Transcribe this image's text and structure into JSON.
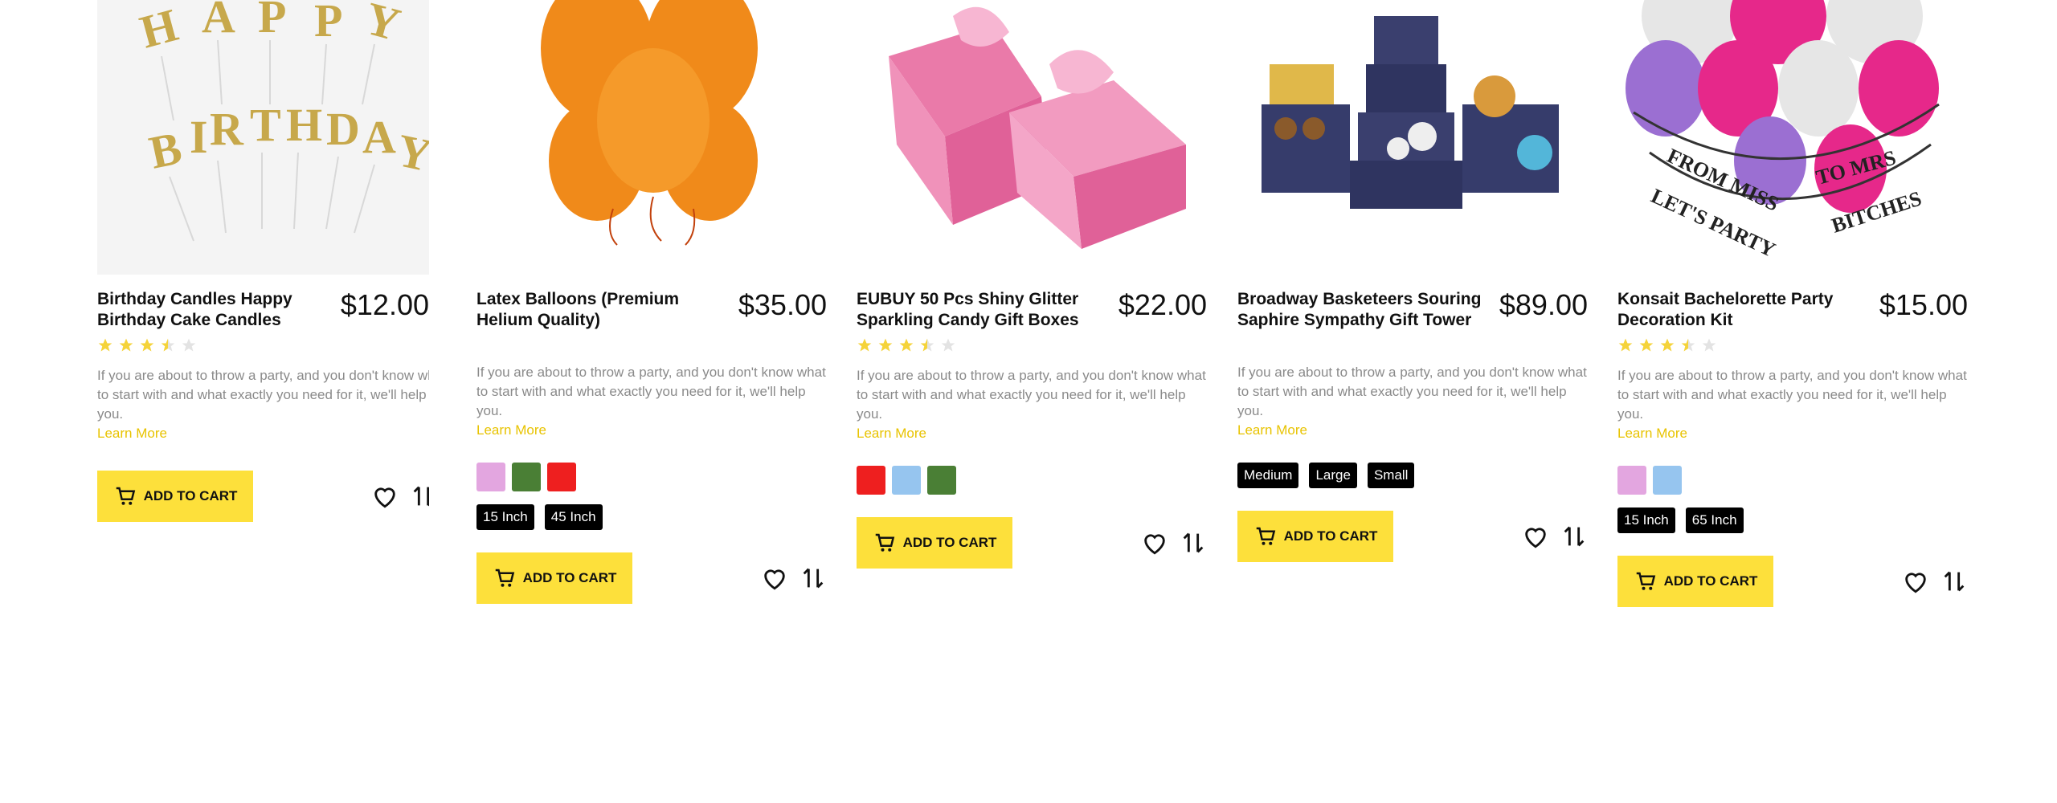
{
  "products": [
    {
      "title": "Birthday Candles Happy Birthday Cake Candles",
      "price": "$12.00",
      "rating_stars": 3.5,
      "description": "If you are about to throw a party, and you don't know what to start with and what exactly you need for it, we'll help you.",
      "learn_more": "Learn More",
      "swatches": [],
      "tags": [],
      "add_to_cart": "ADD TO CART",
      "image_icon": "birthday-candles-image"
    },
    {
      "title": "Latex Balloons (Premium Helium Quality)",
      "price": "$35.00",
      "rating_stars": 0,
      "description": "If you are about to throw a party, and you don't know what to start with and what exactly you need for it, we'll help you.",
      "learn_more": "Learn More",
      "swatches": [
        "#e3a6e0",
        "#4a7f35",
        "#ee1f1f"
      ],
      "tags": [
        "15 Inch",
        "45 Inch"
      ],
      "add_to_cart": "ADD TO CART",
      "image_icon": "orange-balloons-image"
    },
    {
      "title": "EUBUY 50 Pcs Shiny Glitter Sparkling Candy Gift Boxes",
      "price": "$22.00",
      "rating_stars": 3.5,
      "description": "If you are about to throw a party, and you don't know what to start with and what exactly you need for it, we'll help you.",
      "learn_more": "Learn More",
      "swatches": [
        "#ee1f1f",
        "#96c5ef",
        "#4a7f35"
      ],
      "tags": [],
      "add_to_cart": "ADD TO CART",
      "image_icon": "pink-gift-boxes-image"
    },
    {
      "title": "Broadway Basketeers Souring Saphire Sympathy Gift Tower",
      "price": "$89.00",
      "rating_stars": 0,
      "description": "If you are about to throw a party, and you don't know what to start with and what exactly you need for it, we'll help you.",
      "learn_more": "Learn More",
      "swatches": [],
      "tags": [
        "Medium",
        "Large",
        "Small"
      ],
      "add_to_cart": "ADD TO CART",
      "image_icon": "gift-tower-image"
    },
    {
      "title": "Konsait Bachelorette Party Decoration Kit",
      "price": "$15.00",
      "rating_stars": 3.5,
      "description": "If you are about to throw a party, and you don't know what to start with and what exactly you need for it, we'll help you.",
      "learn_more": "Learn More",
      "swatches": [
        "#e3a6e0",
        "#96c5ef"
      ],
      "tags": [
        "15 Inch",
        "65 Inch"
      ],
      "add_to_cart": "ADD TO CART",
      "image_icon": "bachelorette-balloons-image"
    }
  ],
  "colors": {
    "accent": "#fde03b",
    "star": "#f5d33a",
    "star_empty": "#e3e3e3",
    "link": "#e8c300"
  }
}
